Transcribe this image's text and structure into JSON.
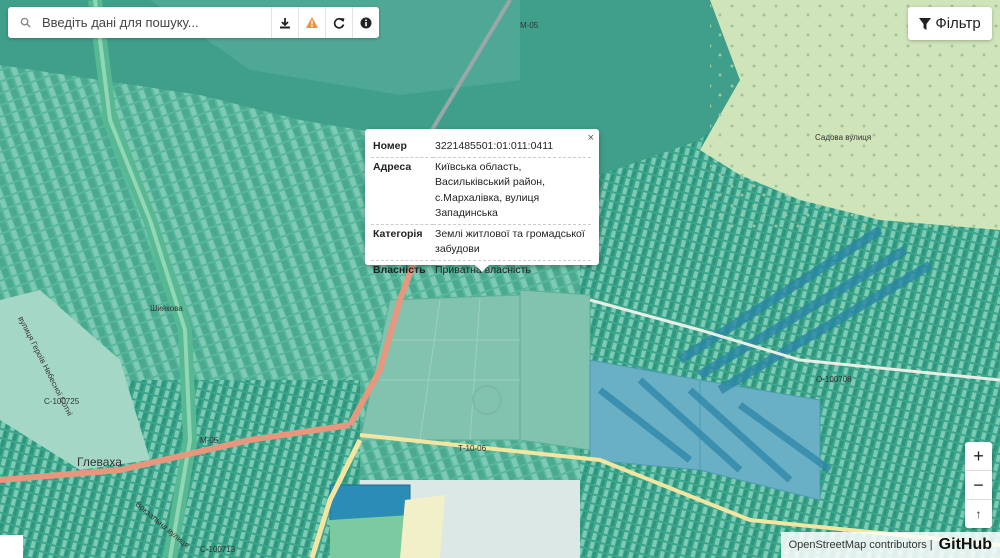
{
  "search": {
    "placeholder": "Введіть дані для пошуку..."
  },
  "toolbar": {
    "icons": [
      "download-icon",
      "warning-icon",
      "refresh-icon",
      "info-icon"
    ],
    "warning_color": "#f0913a"
  },
  "filter": {
    "label": "Фільтр",
    "icon": "funnel-icon"
  },
  "popup": {
    "close": "×",
    "rows": [
      {
        "key": "Номер",
        "value": "3221485501:01:011:0411"
      },
      {
        "key": "Адреса",
        "value": "Київська область, Васильківський район, с.Мархалівка, вулиця Западинська"
      },
      {
        "key": "Категорія",
        "value": "Землі житлової та громадської забудови"
      },
      {
        "key": "Власність",
        "value": "Приватна власність"
      }
    ]
  },
  "zoom": {
    "in": "+",
    "out": "−",
    "reset": "↑"
  },
  "attribution": {
    "osm": "OpenStreetMap contributors |",
    "github": "GitHub"
  },
  "map": {
    "labels": {
      "m05_top": "М-05",
      "shyakova": "Шиякова",
      "sadova": "Садова вулиця",
      "street_heroes": "вулиця Героїв Небесної Сотні",
      "c100725": "С-100725",
      "m05_bottom": "М-05",
      "hlevakha": "Глеваха",
      "t1006": "Т-10-06",
      "o100708": "О-100708",
      "c100713": "С-100713",
      "vokzalna": "Вокзальна вулиця"
    },
    "colors": {
      "background": "#dce8e6",
      "forest": "#3e9f87",
      "parcel": "#52b59b",
      "parcel_light": "#9fd6c4",
      "field_blue": "#6ab0c4",
      "field_dark": "#2d86a8",
      "green_zone": "#cfe4b8",
      "highway": "#e6977d",
      "road_yellow": "#f5e8a0"
    }
  }
}
